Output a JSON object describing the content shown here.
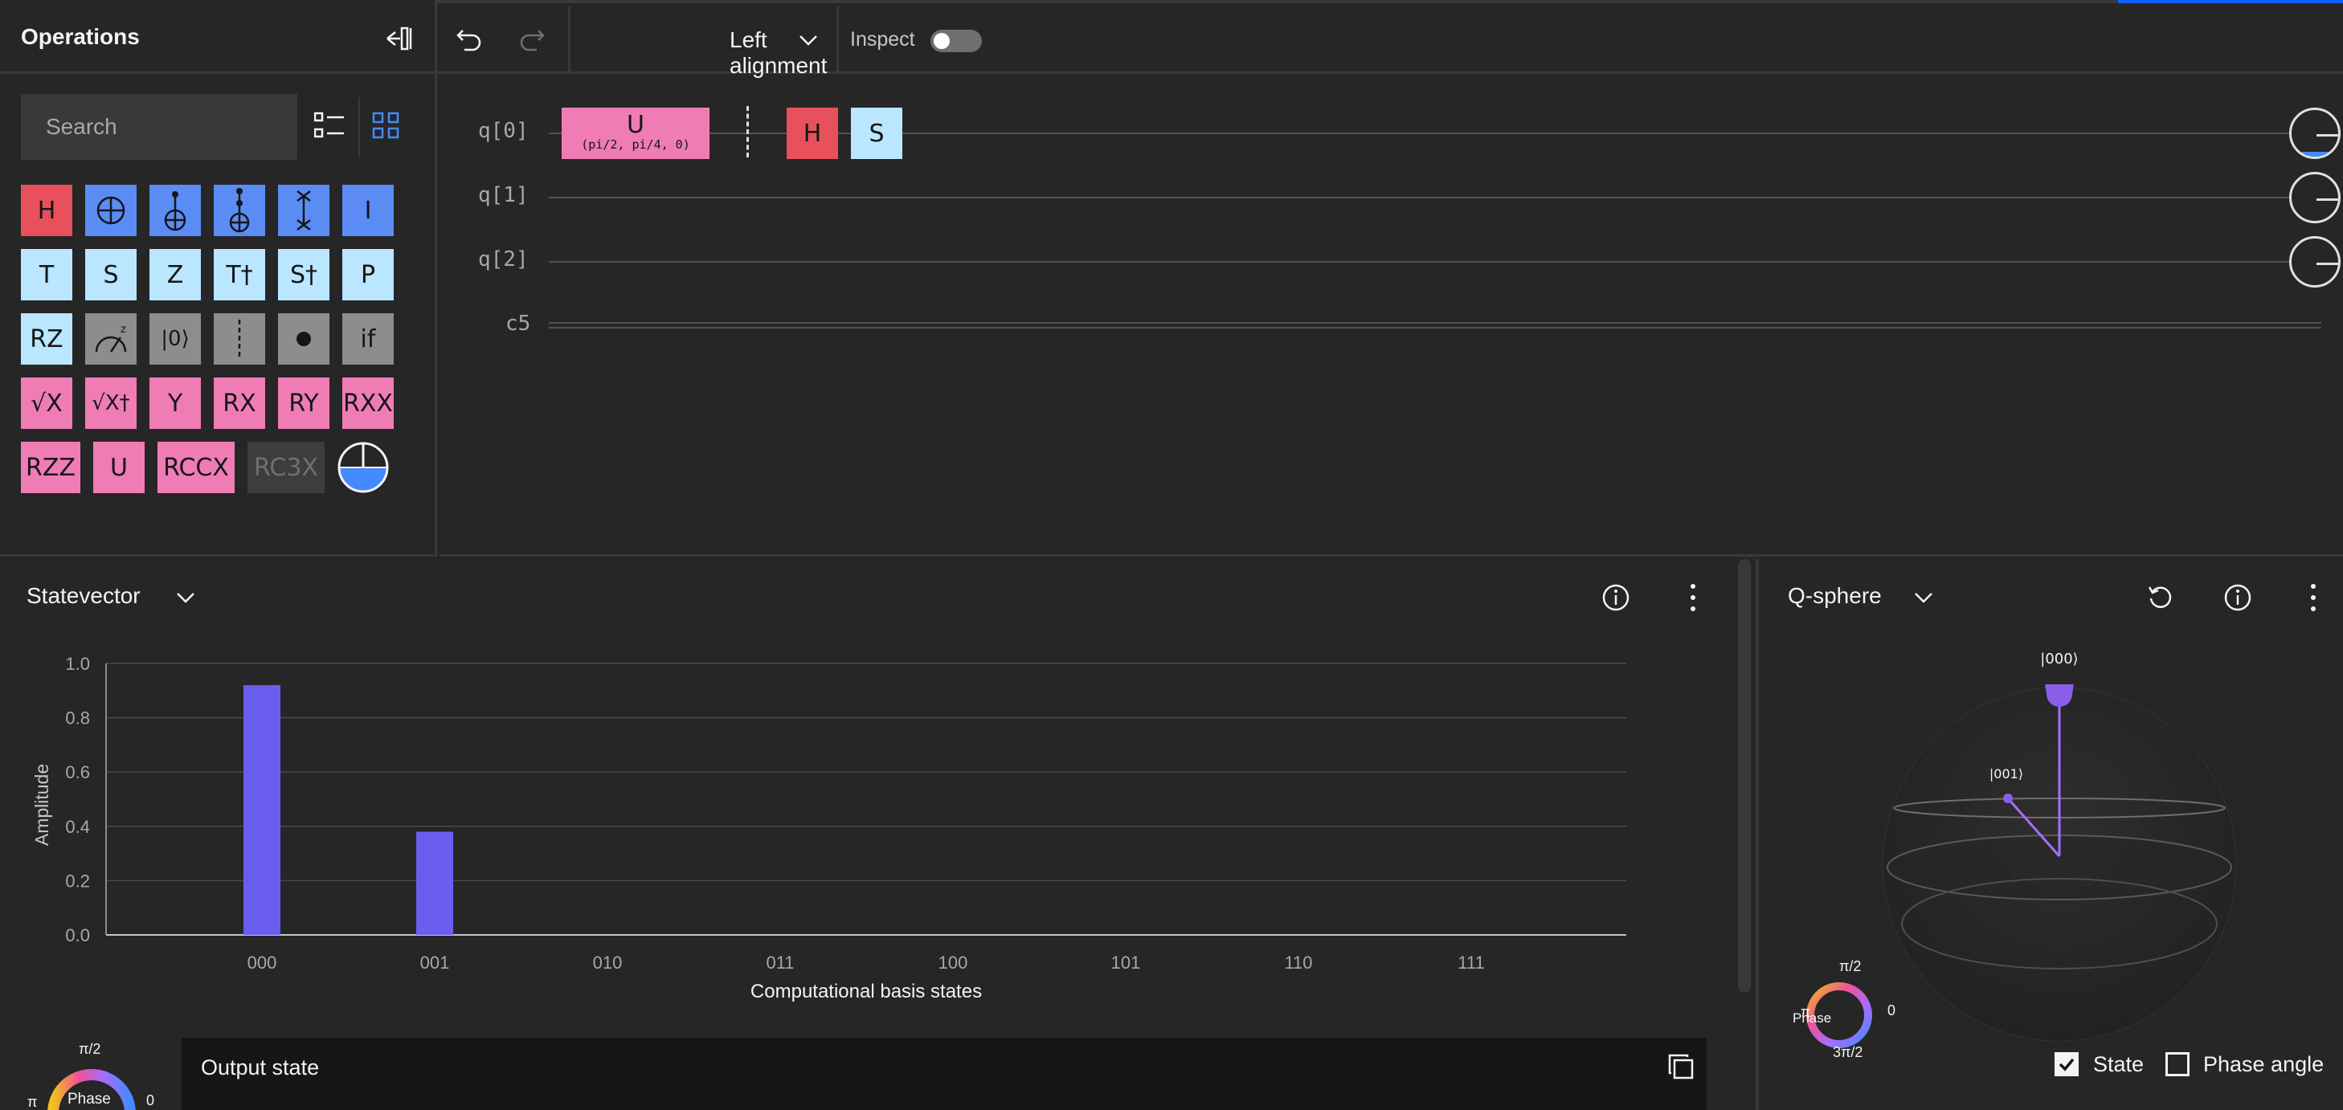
{
  "operations": {
    "title": "Operations",
    "search_placeholder": "Search",
    "gates": [
      {
        "label": "H",
        "style": "red"
      },
      {
        "label": "",
        "icon": "cnot-icon",
        "style": "blue"
      },
      {
        "label": "",
        "icon": "ccx-icon",
        "style": "blue"
      },
      {
        "label": "",
        "icon": "cccx-icon",
        "style": "blue"
      },
      {
        "label": "",
        "icon": "swap-icon",
        "style": "blue"
      },
      {
        "label": "I",
        "style": "blue"
      },
      {
        "label": "T",
        "style": "light"
      },
      {
        "label": "S",
        "style": "light"
      },
      {
        "label": "Z",
        "style": "light"
      },
      {
        "label": "T†",
        "style": "light"
      },
      {
        "label": "S†",
        "style": "light"
      },
      {
        "label": "P",
        "style": "light"
      },
      {
        "label": "RZ",
        "style": "light"
      },
      {
        "label": "",
        "icon": "measure-z-icon",
        "style": "gray"
      },
      {
        "label": "|0⟩",
        "style": "gray"
      },
      {
        "label": "",
        "icon": "barrier-icon",
        "style": "gray"
      },
      {
        "label": "",
        "icon": "control-dot-icon",
        "style": "gray"
      },
      {
        "label": "if",
        "style": "gray"
      },
      {
        "label": "√X",
        "style": "pink"
      },
      {
        "label": "√X†",
        "style": "pink"
      },
      {
        "label": "Y",
        "style": "pink"
      },
      {
        "label": "RX",
        "style": "pink"
      },
      {
        "label": "RY",
        "style": "pink"
      },
      {
        "label": "RXX",
        "style": "pink"
      },
      {
        "label": "RZZ",
        "style": "pink"
      },
      {
        "label": "U",
        "style": "pink"
      },
      {
        "label": "RCCX",
        "style": "pink"
      },
      {
        "label": "RC3X",
        "style": "disabled"
      },
      {
        "label": "",
        "icon": "probability-disk-icon",
        "style": "none"
      }
    ]
  },
  "toolbar": {
    "alignment_value": "Left alignment",
    "inspect_label": "Inspect",
    "inspect_on": false
  },
  "circuit": {
    "wires": [
      "q[0]",
      "q[1]",
      "q[2]"
    ],
    "classical": "c5",
    "u_gate": {
      "name": "U",
      "params": "(pi/2, pi/4, 0)"
    },
    "h_gate": "H",
    "s_gate": "S"
  },
  "statevector": {
    "title": "Statevector",
    "output_title": "Output state",
    "phase_label": "Phase",
    "phase_ticks": {
      "top": "π/2",
      "left": "π",
      "right": "0"
    }
  },
  "chart_data": {
    "type": "bar",
    "categories": [
      "000",
      "001",
      "010",
      "011",
      "100",
      "101",
      "110",
      "111"
    ],
    "values": [
      0.92,
      0.38,
      0,
      0,
      0,
      0,
      0,
      0
    ],
    "xlabel": "Computational basis states",
    "ylabel": "Amplitude",
    "ylim": [
      0,
      1.0
    ],
    "yticks": [
      "0.0",
      "0.2",
      "0.4",
      "0.6",
      "0.8",
      "1.0"
    ],
    "grid": true,
    "bar_color": "#6a5ef0"
  },
  "qsphere": {
    "title": "Q-sphere",
    "state_labels": [
      "|000⟩",
      "|001⟩"
    ],
    "phase_label": "Phase",
    "phase_ticks": {
      "top": "π/2",
      "left": "π",
      "right": "0",
      "bottom": "3π/2"
    },
    "state_checkbox": {
      "label": "State",
      "checked": true
    },
    "phase_angle_checkbox": {
      "label": "Phase angle",
      "checked": false
    }
  },
  "colors": {
    "accent": "#0f62fe",
    "bar": "#6a5ef0",
    "h_gate": "#e8505b",
    "pink_gate": "#f07cb5",
    "light_gate": "#bae6ff"
  }
}
